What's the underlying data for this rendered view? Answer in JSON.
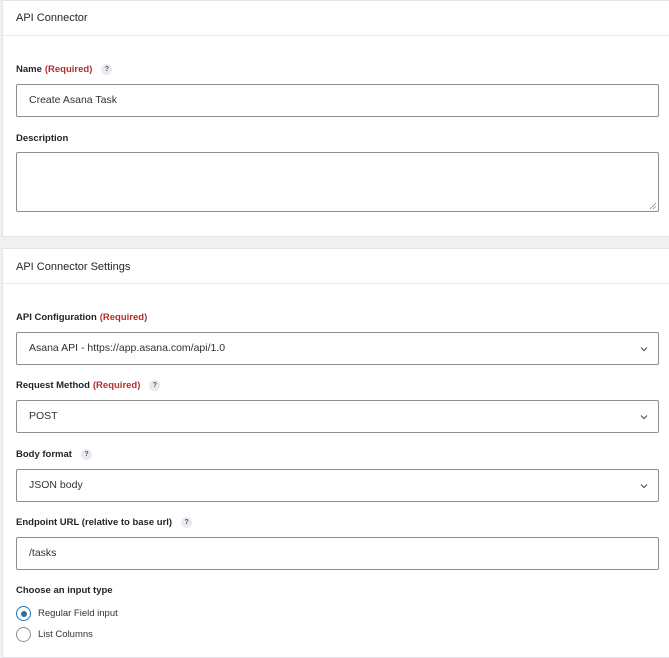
{
  "connector_panel": {
    "title": "API Connector",
    "name_label": "Name",
    "name_required": "(Required)",
    "name_help": "?",
    "name_value": "Create Asana Task",
    "description_label": "Description",
    "description_value": ""
  },
  "settings_panel": {
    "title": "API Connector Settings",
    "api_config_label": "API Configuration",
    "api_config_required": "(Required)",
    "api_config_value": "Asana API - https://app.asana.com/api/1.0",
    "method_label": "Request Method",
    "method_required": "(Required)",
    "method_help": "?",
    "method_value": "POST",
    "body_format_label": "Body format",
    "body_format_help": "?",
    "body_format_value": "JSON body",
    "endpoint_label": "Endpoint URL (relative to base url)",
    "endpoint_help": "?",
    "endpoint_value": "/tasks",
    "input_type_label": "Choose an input type",
    "input_type_options": [
      {
        "label": "Regular Field input",
        "checked": true
      },
      {
        "label": "List Columns",
        "checked": false
      }
    ]
  },
  "colors": {
    "required": "#b32d2e",
    "radio_accent": "#2271b1",
    "border": "#8c8f94"
  },
  "icons": {
    "select_arrow": "chevron-down-icon",
    "help": "question-help-icon"
  }
}
